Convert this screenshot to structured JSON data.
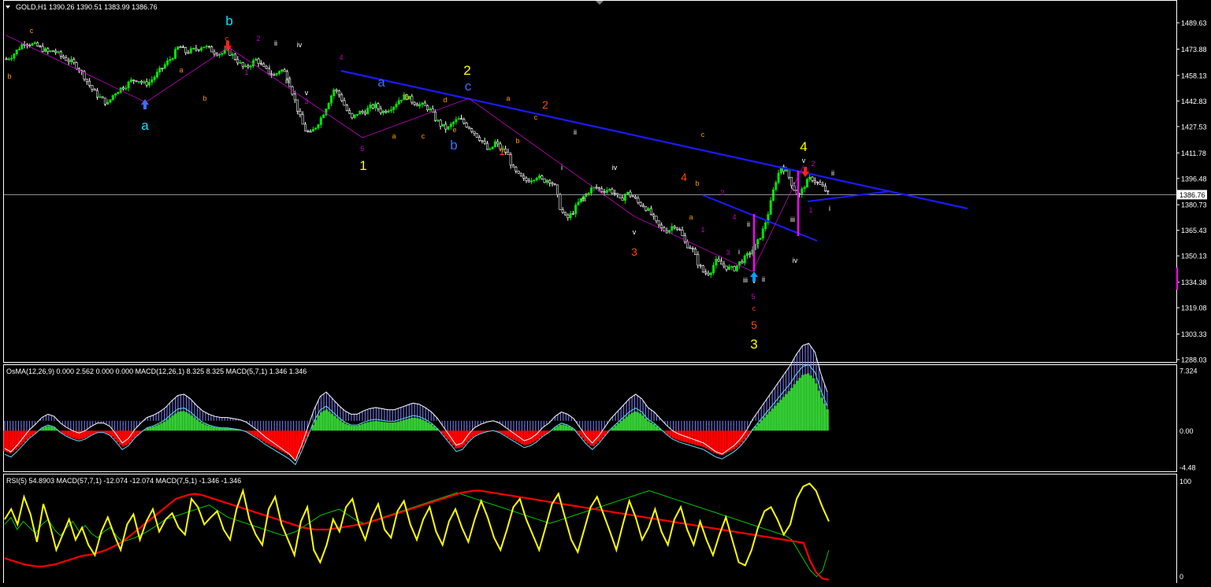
{
  "window": {
    "symbol_header": "GOLD,H1  1390.26 1390.51 1383.99 1386.76",
    "menu_arrow": "triangle-down-icon"
  },
  "colors": {
    "background": "#000000",
    "frame": "#ffffff",
    "bull_candle": "#00e600",
    "trendline": "#1a1aff",
    "elliott_purple": "#c000c0",
    "macd_signal": "#66d9ff",
    "osma_pos": "#33cc33",
    "osma_neg": "#ff0000",
    "macd_stripes": "#8080ff",
    "rsi_line": "#ffff00",
    "slow_macd_line": "#ff0000",
    "fast_macd_line": "#00dd00",
    "wave_yellow": "#ffff00",
    "wave_cyan": "#00e5ff",
    "wave_red": "#ff4500",
    "wave_orange": "#ff9900",
    "wave_blue": "#3a6fff"
  },
  "chart_data": [
    {
      "type": "line",
      "series_type": "candlestick",
      "y_ticks": [
        "1489.63",
        "1473.88",
        "1458.13",
        "1442.83",
        "1427.53",
        "1411.78",
        "1396.48",
        "1380.73",
        "1365.43",
        "1350.13",
        "1334.38",
        "1319.08",
        "1303.33",
        "1288.03"
      ],
      "ylim": [
        1288.03,
        1489.63
      ],
      "current_price_label": "1386.76",
      "current_price": 1386.76,
      "series": [
        {
          "name": "",
          "values": [
            1468,
            1470,
            1474,
            1478,
            1477,
            1476,
            1474,
            1472,
            1473,
            1470,
            1468,
            1466,
            1463,
            1458,
            1452,
            1447,
            1444,
            1441,
            1447,
            1450,
            1452,
            1455,
            1456,
            1453,
            1454,
            1458,
            1462,
            1466,
            1470,
            1476,
            1472,
            1473,
            1474,
            1476,
            1474,
            1472,
            1471,
            1473,
            1470,
            1466,
            1462,
            1465,
            1468,
            1463,
            1460,
            1458,
            1462,
            1459,
            1448,
            1436,
            1426,
            1423,
            1428,
            1434,
            1442,
            1450,
            1446,
            1438,
            1432,
            1436,
            1436,
            1439,
            1440,
            1436,
            1438,
            1440,
            1444,
            1446,
            1443,
            1441,
            1440,
            1438,
            1432,
            1428,
            1426,
            1430,
            1432,
            1429,
            1426,
            1422,
            1418,
            1412,
            1418,
            1414,
            1412,
            1402,
            1398,
            1395,
            1396,
            1398,
            1395,
            1396,
            1392,
            1378,
            1372,
            1376,
            1382,
            1386,
            1390,
            1391,
            1389,
            1390,
            1388,
            1383,
            1388,
            1386,
            1382,
            1380,
            1376,
            1370,
            1366,
            1365,
            1369,
            1365,
            1357,
            1355,
            1346,
            1340,
            1340,
            1347,
            1345,
            1343,
            1342,
            1346,
            1349,
            1353,
            1358,
            1366,
            1378,
            1394,
            1404,
            1400,
            1391,
            1386,
            1393,
            1397,
            1394,
            1391,
            1387
          ]
        }
      ]
    },
    {
      "type": "bar",
      "series_type": "osma-macd",
      "label": "OsMA(12,26,9) 0.000 2.562 0.000 0.000  MACD(12,26,1) 8.325 8.325  MACD(5,7,1) 1.346 1.346",
      "y_ticks": [
        "7.324",
        "0.00",
        "-4.48"
      ],
      "ylim": [
        -4.48,
        7.324
      ],
      "series": [
        {
          "name": "",
          "values": [
            -2.5,
            -2.8,
            -2.2,
            -1.5,
            -0.8,
            -0.3,
            0.3,
            0.6,
            0.4,
            -0.2,
            -0.6,
            -0.9,
            -1.1,
            -0.9,
            -0.5,
            -0.2,
            -0.2,
            -0.5,
            -1.2,
            -2.0,
            -1.6,
            -0.8,
            -0.2,
            0.3,
            0.5,
            0.8,
            1.2,
            1.8,
            2.3,
            2.4,
            2.0,
            1.4,
            0.9,
            0.6,
            0.4,
            0.3,
            0.3,
            0.2,
            0.1,
            -0.1,
            -0.5,
            -0.9,
            -1.4,
            -1.8,
            -2.2,
            -2.6,
            -3.0,
            -3.6,
            -2.2,
            -0.6,
            1.0,
            2.2,
            2.6,
            2.0,
            1.4,
            0.9,
            0.6,
            0.6,
            0.9,
            1.1,
            1.2,
            1.1,
            1.0,
            1.0,
            1.2,
            1.4,
            1.6,
            1.5,
            1.2,
            0.8,
            0.2,
            -0.6,
            -1.4,
            -2.2,
            -2.0,
            -1.2,
            -0.6,
            -0.3,
            -0.1,
            0.0,
            -0.2,
            -0.6,
            -1.0,
            -1.4,
            -1.8,
            -1.6,
            -1.2,
            -0.6,
            -0.2,
            0.4,
            0.8,
            0.6,
            0.2,
            -0.6,
            -1.4,
            -2.0,
            -1.4,
            -0.6,
            0.2,
            0.8,
            1.4,
            2.0,
            2.4,
            2.0,
            1.2,
            0.8,
            0.2,
            -0.4,
            -0.9,
            -1.2,
            -1.4,
            -1.6,
            -1.8,
            -2.0,
            -2.4,
            -2.8,
            -3.0,
            -2.6,
            -2.2,
            -1.6,
            -0.8,
            0.2,
            1.0,
            1.8,
            2.6,
            3.4,
            4.2,
            5.0,
            6.0,
            6.8,
            7.0,
            6.2,
            4.2,
            2.6
          ]
        }
      ]
    },
    {
      "type": "line",
      "series_type": "oscillators",
      "label": "RSI(5) 54.8903  MACD(57,7,1) -12.074 -12.074  MACD(7,5,1) -1.346 -1.346",
      "y_ticks": [
        "100",
        "0"
      ],
      "ylim": [
        0,
        100
      ],
      "series": [
        {
          "name": "",
          "values": [
            60,
            70,
            55,
            82,
            65,
            38,
            75,
            55,
            30,
            45,
            60,
            40,
            52,
            35,
            25,
            48,
            62,
            45,
            30,
            55,
            65,
            40,
            58,
            70,
            48,
            60,
            66,
            52,
            45,
            80,
            72,
            55,
            62,
            68,
            50,
            40,
            70,
            88,
            60,
            45,
            35,
            70,
            82,
            55,
            40,
            25,
            58,
            72,
            30,
            18,
            35,
            60,
            48,
            72,
            80,
            55,
            40,
            62,
            75,
            50,
            42,
            68,
            78,
            55,
            40,
            60,
            72,
            48,
            35,
            58,
            70,
            52,
            38,
            60,
            78,
            62,
            42,
            30,
            50,
            72,
            80,
            60,
            45,
            30,
            52,
            75,
            85,
            62,
            40,
            28,
            50,
            72,
            82,
            65,
            48,
            30,
            55,
            78,
            62,
            40,
            52,
            70,
            48,
            35,
            60,
            72,
            50,
            35,
            58,
            40,
            25,
            45,
            62,
            40,
            18,
            15,
            30,
            52,
            68,
            72,
            60,
            45,
            55,
            80,
            92,
            95,
            88,
            72,
            58
          ]
        },
        {
          "name": "",
          "values": [
            22,
            20,
            18,
            16,
            15,
            14,
            14,
            15,
            16,
            18,
            20,
            22,
            24,
            25,
            26,
            28,
            30,
            33,
            36,
            40,
            45,
            50,
            55,
            60,
            65,
            70,
            75,
            80,
            82,
            84,
            85,
            84,
            82,
            80,
            78,
            76,
            74,
            72,
            70,
            68,
            66,
            64,
            62,
            60,
            58,
            56,
            54,
            52,
            51,
            50,
            50,
            50,
            51,
            52,
            53,
            54,
            55,
            56,
            58,
            60,
            62,
            64,
            66,
            68,
            70,
            72,
            74,
            76,
            78,
            80,
            82,
            84,
            86,
            87,
            88,
            88,
            87,
            86,
            85,
            84,
            83,
            82,
            81,
            80,
            79,
            78,
            77,
            76,
            75,
            74,
            73,
            72,
            71,
            70,
            69,
            68,
            67,
            66,
            65,
            64,
            63,
            62,
            61,
            60,
            59,
            58,
            57,
            56,
            55,
            54,
            53,
            52,
            51,
            50,
            49,
            48,
            47,
            46,
            45,
            44,
            43,
            42,
            41,
            40,
            39,
            38,
            37,
            20,
            8,
            2,
            1
          ]
        },
        {
          "name": "",
          "values": [
            55,
            62,
            50,
            58,
            52,
            46,
            55,
            60,
            50,
            44,
            52,
            58,
            48,
            54,
            46,
            42,
            48,
            52,
            44,
            38,
            40,
            42,
            45,
            48,
            52,
            56,
            60,
            62,
            64,
            66,
            68,
            70,
            72,
            74,
            70,
            66,
            62,
            60,
            58,
            56,
            54,
            52,
            50,
            48,
            46,
            44,
            46,
            48,
            52,
            56,
            60,
            64,
            66,
            68,
            70,
            66,
            62,
            58,
            56,
            58,
            60,
            62,
            64,
            66,
            68,
            70,
            72,
            74,
            76,
            78,
            80,
            82,
            84,
            86,
            84,
            82,
            80,
            78,
            76,
            74,
            72,
            70,
            68,
            66,
            64,
            62,
            60,
            58,
            56,
            58,
            60,
            62,
            64,
            66,
            68,
            70,
            72,
            74,
            76,
            78,
            80,
            82,
            84,
            86,
            88,
            86,
            84,
            82,
            80,
            78,
            76,
            74,
            72,
            70,
            68,
            66,
            64,
            62,
            60,
            58,
            56,
            54,
            52,
            50,
            48,
            46,
            44,
            40,
            30,
            20,
            10,
            4,
            10,
            30
          ]
        }
      ]
    }
  ],
  "wave_labels": [
    {
      "text": "c",
      "color": "#ff9900",
      "size": "small"
    },
    {
      "text": "b",
      "color": "#ff9900",
      "size": "small"
    },
    {
      "text": "a",
      "color": "#00e5ff",
      "size": "large"
    },
    {
      "text": "b",
      "color": "#00e5ff",
      "size": "large"
    },
    {
      "text": "c",
      "color": "#ff4500",
      "size": "small"
    },
    {
      "text": "a",
      "color": "#ff9900",
      "size": "small"
    },
    {
      "text": "b",
      "color": "#ff9900",
      "size": "small"
    },
    {
      "text": "1",
      "color": "#c000c0",
      "size": "small"
    },
    {
      "text": "2",
      "color": "#c000c0",
      "size": "small"
    },
    {
      "text": "i",
      "color": "#ffffff",
      "size": "small"
    },
    {
      "text": "ii",
      "color": "#ffffff",
      "size": "small"
    },
    {
      "text": "iii",
      "color": "#ffffff",
      "size": "small"
    },
    {
      "text": "iv",
      "color": "#ffffff",
      "size": "small"
    },
    {
      "text": "v",
      "color": "#ffffff",
      "size": "small"
    },
    {
      "text": "3",
      "color": "#c000c0",
      "size": "small"
    },
    {
      "text": "4",
      "color": "#c000c0",
      "size": "small"
    },
    {
      "text": "5",
      "color": "#c000c0",
      "size": "small"
    },
    {
      "text": "1",
      "color": "#ffff00",
      "size": "large"
    },
    {
      "text": "a",
      "color": "#3a6fff",
      "size": "large"
    },
    {
      "text": "b",
      "color": "#3a6fff",
      "size": "large"
    },
    {
      "text": "c",
      "color": "#3a6fff",
      "size": "large"
    },
    {
      "text": "2",
      "color": "#ffff00",
      "size": "large"
    },
    {
      "text": "a",
      "color": "#ff9900",
      "size": "small"
    },
    {
      "text": "b",
      "color": "#ff9900",
      "size": "small"
    },
    {
      "text": "c",
      "color": "#ff9900",
      "size": "small"
    },
    {
      "text": "d",
      "color": "#ff9900",
      "size": "small"
    },
    {
      "text": "e",
      "color": "#ff9900",
      "size": "small"
    },
    {
      "text": "a",
      "color": "#ff9900",
      "size": "small"
    },
    {
      "text": "b",
      "color": "#ff9900",
      "size": "small"
    },
    {
      "text": "c",
      "color": "#ff9900",
      "size": "small"
    },
    {
      "text": "1",
      "color": "#ff4500",
      "size": "medium"
    },
    {
      "text": "2",
      "color": "#ff4500",
      "size": "medium"
    },
    {
      "text": "ii",
      "color": "#ffffff",
      "size": "small"
    },
    {
      "text": "i",
      "color": "#ffffff",
      "size": "small"
    },
    {
      "text": "iii",
      "color": "#ffffff",
      "size": "small"
    },
    {
      "text": "iv",
      "color": "#ffffff",
      "size": "small"
    },
    {
      "text": "v",
      "color": "#ffffff",
      "size": "small"
    },
    {
      "text": "3",
      "color": "#ff4500",
      "size": "medium"
    },
    {
      "text": "4",
      "color": "#ff4500",
      "size": "medium"
    },
    {
      "text": "b",
      "color": "#ff9900",
      "size": "small"
    },
    {
      "text": "a",
      "color": "#ff9900",
      "size": "small"
    },
    {
      "text": "c",
      "color": "#ff9900",
      "size": "small"
    },
    {
      "text": "2",
      "color": "#c000c0",
      "size": "small"
    },
    {
      "text": "1",
      "color": "#c000c0",
      "size": "small"
    },
    {
      "text": "4",
      "color": "#c000c0",
      "size": "small"
    },
    {
      "text": "3",
      "color": "#c000c0",
      "size": "small"
    },
    {
      "text": "ii",
      "color": "#ffffff",
      "size": "small"
    },
    {
      "text": "i",
      "color": "#ffffff",
      "size": "small"
    },
    {
      "text": "iii",
      "color": "#ffffff",
      "size": "small"
    },
    {
      "text": "v",
      "color": "#ffffff",
      "size": "small"
    },
    {
      "text": "ii",
      "color": "#ffffff",
      "size": "small"
    },
    {
      "text": "i",
      "color": "#ffffff",
      "size": "small"
    },
    {
      "text": "5",
      "color": "#c000c0",
      "size": "small"
    },
    {
      "text": "c",
      "color": "#ff4500",
      "size": "small"
    },
    {
      "text": "5",
      "color": "#ff4500",
      "size": "medium"
    },
    {
      "text": "3",
      "color": "#ffff00",
      "size": "large"
    },
    {
      "text": "iii",
      "color": "#ffffff",
      "size": "small"
    },
    {
      "text": "iv",
      "color": "#ffffff",
      "size": "small"
    },
    {
      "text": "4",
      "color": "#ffff00",
      "size": "large"
    },
    {
      "text": "v",
      "color": "#ffffff",
      "size": "small"
    },
    {
      "text": "2",
      "color": "#c000c0",
      "size": "small"
    },
    {
      "text": "1",
      "color": "#c000c0",
      "size": "small"
    },
    {
      "text": "ii",
      "color": "#ffffff",
      "size": "small"
    },
    {
      "text": "i",
      "color": "#ffffff",
      "size": "small"
    }
  ],
  "arrows": [
    {
      "icon": "arrow-up-icon",
      "color": "#3a6fff"
    },
    {
      "icon": "arrow-down-icon",
      "color": "#ff2020"
    },
    {
      "icon": "arrow-up-icon",
      "color": "#00a0ff"
    },
    {
      "icon": "arrow-down-icon",
      "color": "#ff2020"
    }
  ]
}
